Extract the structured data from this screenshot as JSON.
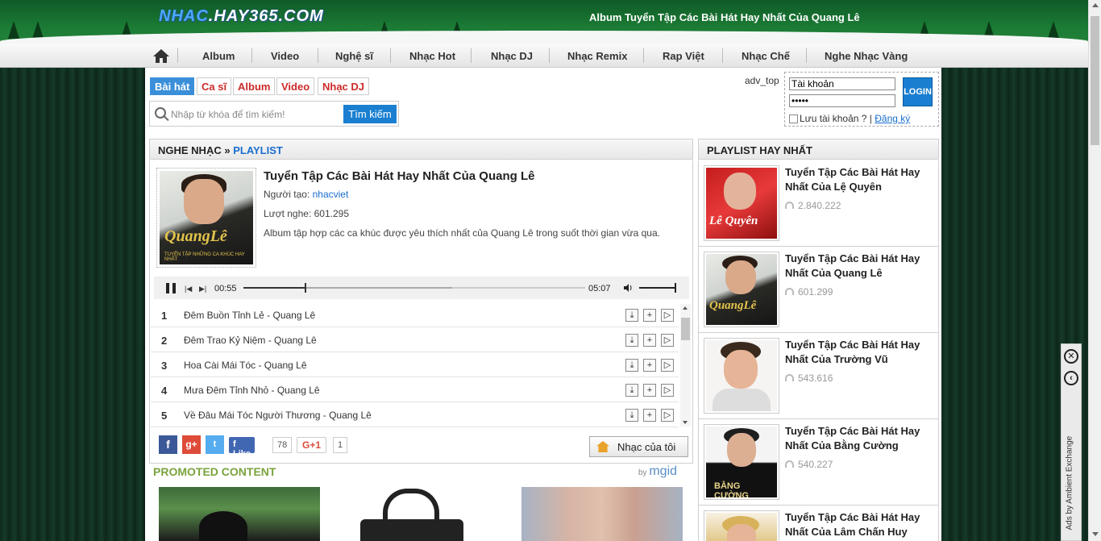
{
  "site": {
    "logo_a": "NHAC",
    "logo_b": ".HAY365.COM",
    "banner_title": "Album Tuyển Tập Các Bài Hát Hay Nhất Của Quang Lê"
  },
  "nav": {
    "items": [
      "Album",
      "Video",
      "Nghệ sĩ",
      "Nhạc Hot",
      "Nhạc DJ",
      "Nhạc Remix",
      "Rap Việt",
      "Nhạc Chế",
      "Nghe Nhạc Vàng"
    ]
  },
  "search": {
    "tabs": [
      "Bài hát",
      "Ca sĩ",
      "Album",
      "Video",
      "Nhạc DJ"
    ],
    "placeholder": "Nhập từ khóa để tìm kiếm!",
    "button": "Tìm kiếm"
  },
  "login": {
    "adv": "adv_top",
    "username": "Tài khoản",
    "password": "•••••",
    "button": "LOGIN",
    "remember": "Lưu tài khoản ?",
    "divider": "|",
    "register": "Đăng ký"
  },
  "breadcrumb": {
    "part1": "NGHE NHẠC",
    "sep": " » ",
    "part2": "PLAYLIST"
  },
  "album": {
    "title": "Tuyển Tập Các Bài Hát Hay Nhất Của Quang Lê",
    "creator_label": "Người tạo: ",
    "creator": "nhacviet",
    "plays_label": "Lượt nghe: ",
    "plays": "601.295",
    "description": "Album tập hợp các ca khúc được yêu thích nhất của Quang Lê trong suốt thời gian vừa qua.",
    "cover_name": "QuangLê",
    "cover_sub": "TUYỂN TẬP NHỮNG CA KHÚC HAY NHẤT"
  },
  "player": {
    "current_time": "00:55",
    "duration": "05:07",
    "progress": 0.18,
    "buffered": 0.61,
    "volume": 1.0
  },
  "tracks": [
    {
      "num": "1",
      "name": "Đêm Buồn Tỉnh Lẻ - Quang Lê"
    },
    {
      "num": "2",
      "name": "Đêm Trao Kỷ Niệm - Quang Lê"
    },
    {
      "num": "3",
      "name": "Hoa Cài Mái Tóc - Quang Lê"
    },
    {
      "num": "4",
      "name": "Mưa Đêm Tỉnh Nhỏ - Quang Lê"
    },
    {
      "num": "5",
      "name": "Về Đâu Mái Tóc Người Thương - Quang Lê"
    }
  ],
  "social": {
    "fb_like": "Like",
    "fb_count": "78",
    "gplus": "G+1",
    "gplus_count": "1",
    "my_music": "Nhạc của tôi"
  },
  "promo": {
    "title": "PROMOTED CONTENT",
    "by": "by ",
    "brand": "mgid"
  },
  "sidebar": {
    "title": "PLAYLIST HAY NHẤT",
    "items": [
      {
        "title": "Tuyển Tập Các Bài Hát Hay Nhất Của Lệ Quyên",
        "count": "2.840.222",
        "thumb_text": "Lê Quyên"
      },
      {
        "title": "Tuyển Tập Các Bài Hát Hay Nhất Của Quang Lê",
        "count": "601.299",
        "thumb_text": "QuangLê"
      },
      {
        "title": "Tuyển Tập Các Bài Hát Hay Nhất Của Trường Vũ",
        "count": "543.616",
        "thumb_text": ""
      },
      {
        "title": "Tuyển Tập Các Bài Hát Hay Nhất Của Bằng Cường",
        "count": "540.227",
        "thumb_text": "BẰNG CƯỜNG"
      },
      {
        "title": "Tuyển Tập Các Bài Hát Hay Nhất Của Lâm Chấn Huy",
        "count": "",
        "thumb_text": ""
      }
    ]
  },
  "ad": {
    "close": "✕",
    "collapse": "‹",
    "text": "Ads by Ambient Exchange"
  }
}
